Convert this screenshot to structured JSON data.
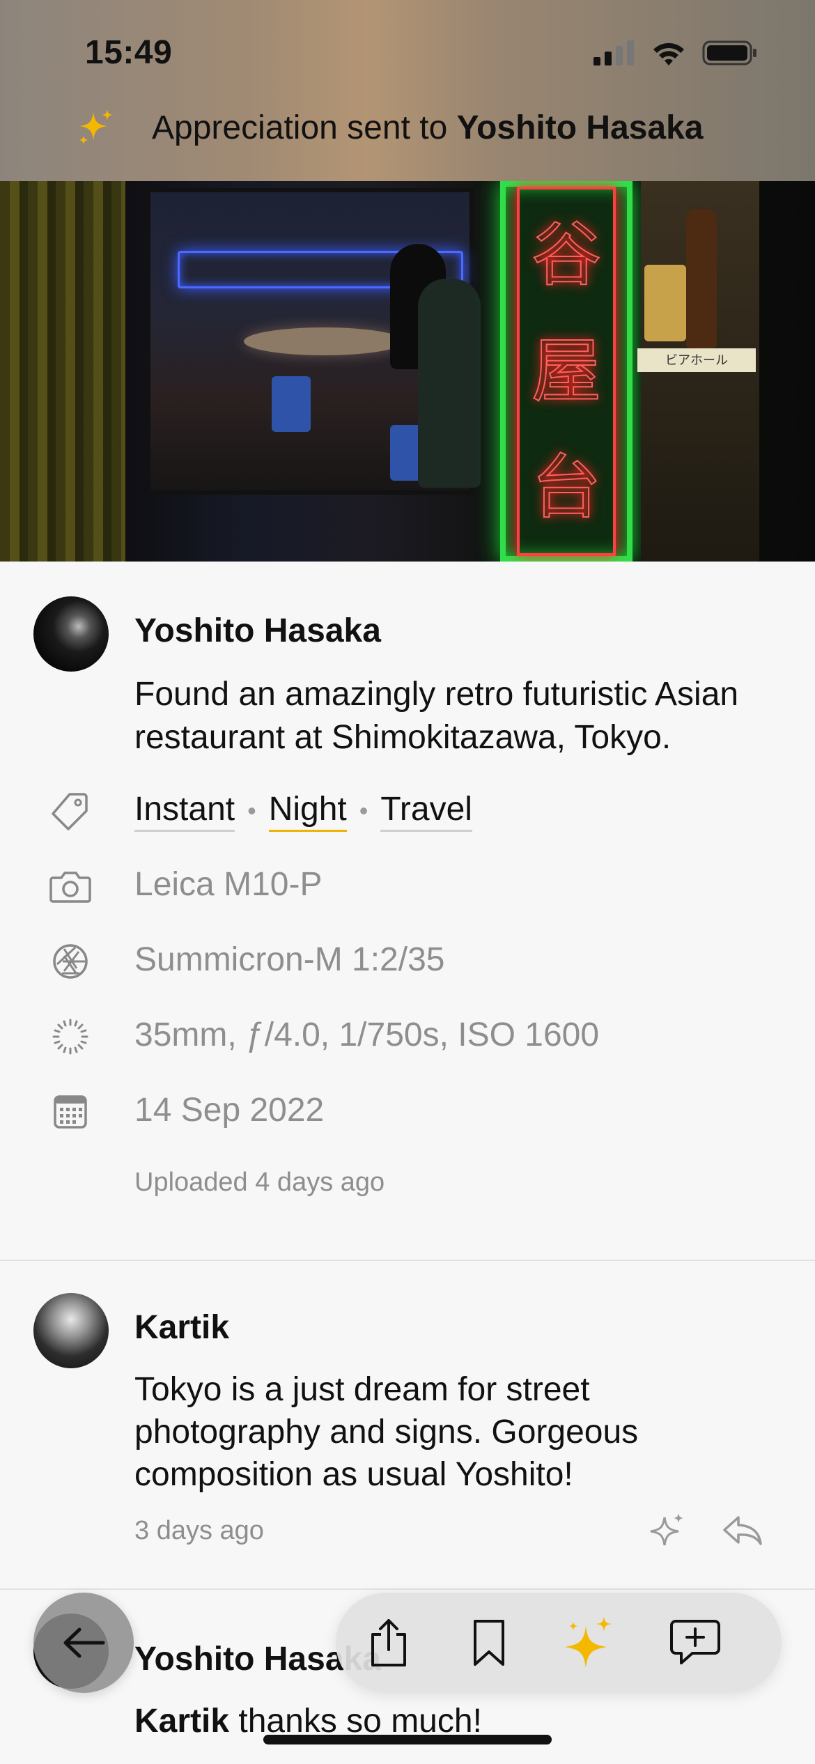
{
  "status_bar": {
    "time": "15:49"
  },
  "notification": {
    "prefix": "Appreciation sent to ",
    "name": "Yoshito Hasaka"
  },
  "hero": {
    "sign_glyphs": [
      "谷",
      "屋",
      "台"
    ],
    "shelf_label": "ビアホール"
  },
  "post": {
    "author": "Yoshito Hasaka",
    "text": "Found an amazingly retro futuristic Asian restaurant at Shimokitazawa, Tokyo.",
    "tags": [
      "Instant",
      "Night",
      "Travel"
    ],
    "camera": "Leica M10-P",
    "lens": "Summicron-M 1:2/35",
    "exposure": "35mm, ƒ/4.0, 1/750s, ISO 1600",
    "date": "14 Sep 2022",
    "uploaded": "Uploaded 4 days ago"
  },
  "comments": [
    {
      "author": "Kartik",
      "text": "Tokyo is a just dream for street photography and signs. Gorgeous composition as usual Yoshito!",
      "time": "3 days ago"
    },
    {
      "author": "Yoshito Hasaka",
      "reply_to": "Kartik",
      "text": " thanks so much!"
    }
  ],
  "colors": {
    "accent": "#F5B800",
    "background": "#F7F7F7",
    "secondary_text": "#8E8E8E"
  },
  "toolbar": {
    "icons": [
      "back-arrow-icon",
      "share-icon",
      "bookmark-icon",
      "sparkle-icon",
      "comment-add-icon"
    ]
  }
}
